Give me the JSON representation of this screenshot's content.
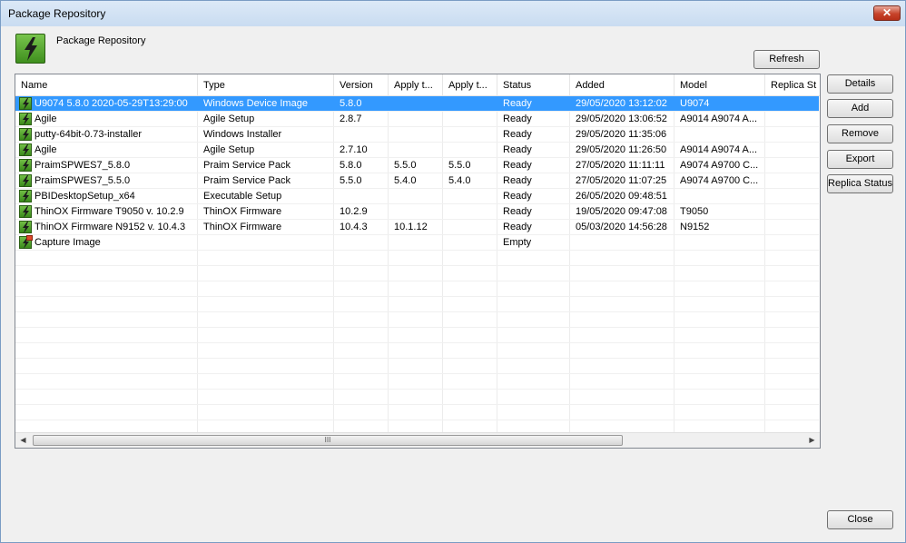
{
  "window": {
    "title": "Package Repository",
    "close_glyph": "✕"
  },
  "header": {
    "text": "Package Repository",
    "icon": "lightning-package-icon",
    "accent": "#4f9f2a"
  },
  "buttons": {
    "refresh": "Refresh",
    "details": "Details",
    "add": "Add",
    "remove": "Remove",
    "export": "Export",
    "replica_status": "Replica Status",
    "close": "Close"
  },
  "columns": [
    "Name",
    "Type",
    "Version",
    "Apply t...",
    "Apply t...",
    "Status",
    "Added",
    "Model",
    "Replica St"
  ],
  "rows": [
    {
      "name": "U9074 5.8.0 2020-05-29T13:29:00",
      "type": "Windows Device Image",
      "version": "5.8.0",
      "apply1": "",
      "apply2": "",
      "status": "Ready",
      "added": "29/05/2020 13:12:02",
      "model": "U9074",
      "replica": "",
      "selected": true
    },
    {
      "name": "Agile",
      "type": "Agile Setup",
      "version": "2.8.7",
      "apply1": "",
      "apply2": "",
      "status": "Ready",
      "added": "29/05/2020 13:06:52",
      "model": "A9014 A9074 A...",
      "replica": ""
    },
    {
      "name": "putty-64bit-0.73-installer",
      "type": "Windows Installer",
      "version": "",
      "apply1": "",
      "apply2": "",
      "status": "Ready",
      "added": "29/05/2020 11:35:06",
      "model": "",
      "replica": ""
    },
    {
      "name": "Agile",
      "type": "Agile Setup",
      "version": "2.7.10",
      "apply1": "",
      "apply2": "",
      "status": "Ready",
      "added": "29/05/2020 11:26:50",
      "model": "A9014 A9074 A...",
      "replica": ""
    },
    {
      "name": "PraimSPWES7_5.8.0",
      "type": "Praim Service Pack",
      "version": "5.8.0",
      "apply1": "5.5.0",
      "apply2": "5.5.0",
      "status": "Ready",
      "added": "27/05/2020 11:11:11",
      "model": "A9074 A9700 C...",
      "replica": ""
    },
    {
      "name": "PraimSPWES7_5.5.0",
      "type": "Praim Service Pack",
      "version": "5.5.0",
      "apply1": "5.4.0",
      "apply2": "5.4.0",
      "status": "Ready",
      "added": "27/05/2020 11:07:25",
      "model": "A9074 A9700 C...",
      "replica": ""
    },
    {
      "name": "PBIDesktopSetup_x64",
      "type": "Executable Setup",
      "version": "",
      "apply1": "",
      "apply2": "",
      "status": "Ready",
      "added": "26/05/2020 09:48:51",
      "model": "",
      "replica": ""
    },
    {
      "name": "ThinOX Firmware T9050 v. 10.2.9",
      "type": "ThinOX Firmware",
      "version": "10.2.9",
      "apply1": "",
      "apply2": "",
      "status": "Ready",
      "added": "19/05/2020 09:47:08",
      "model": "T9050",
      "replica": ""
    },
    {
      "name": "ThinOX Firmware N9152 v. 10.4.3",
      "type": "ThinOX Firmware",
      "version": "10.4.3",
      "apply1": "10.1.12",
      "apply2": "",
      "status": "Ready",
      "added": "05/03/2020 14:56:28",
      "model": "N9152",
      "replica": ""
    },
    {
      "name": "Capture Image",
      "type": "",
      "version": "",
      "apply1": "",
      "apply2": "",
      "status": "Empty",
      "added": "",
      "model": "",
      "replica": "",
      "capture": true
    }
  ],
  "scrollbar": {
    "grip": "III",
    "left_arrow": "◀",
    "right_arrow": "▶"
  },
  "colors": {
    "selection": "#3399ff"
  }
}
